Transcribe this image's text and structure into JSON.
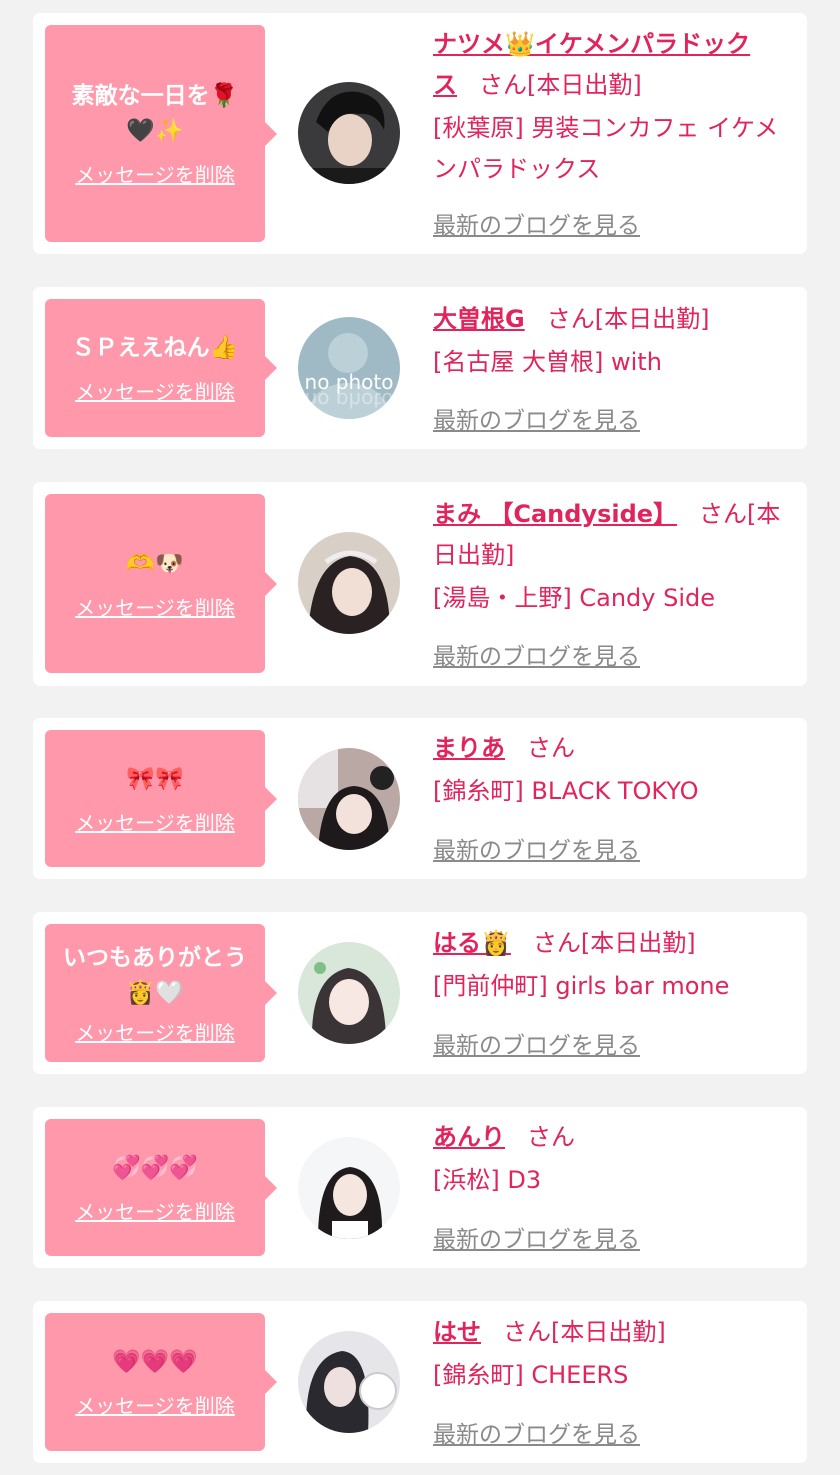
{
  "colors": {
    "background": "#f2f2f2",
    "card": "#ffffff",
    "bubble": "#fe98aa",
    "accent": "#e1245c",
    "link_gray": "#8a8a8a"
  },
  "delete_label": "メッセージを削除",
  "blog_label": "最新のブログを見る",
  "cards": [
    {
      "message": "素敵な一日を🌹🖤✨",
      "name": "ナツメ👑イケメンパラドックス",
      "suffix": "さん[本日出勤]",
      "shop": "[秋葉原] 男装コンカフェ イケメンパラドックス",
      "avatar_icon": "avatar-photo"
    },
    {
      "message": "ＳＰええねん👍",
      "name": "大曽根G",
      "suffix": "さん[本日出勤]",
      "shop": "[名古屋 大曽根] with",
      "avatar_icon": "no-photo-avatar"
    },
    {
      "message": "🫶🐶",
      "name": "まみ 【Candyside】",
      "suffix": "さん[本日出勤]",
      "shop": "[湯島・上野] Candy Side",
      "avatar_icon": "avatar-photo"
    },
    {
      "message": "🎀🎀",
      "name": "まりあ",
      "suffix": "さん",
      "shop": "[錦糸町] BLACK TOKYO",
      "avatar_icon": "avatar-photo"
    },
    {
      "message": "いつもありがとう👸🤍",
      "name": "はる👸",
      "suffix": "さん[本日出勤]",
      "shop": "[門前仲町] girls bar mone",
      "avatar_icon": "avatar-photo"
    },
    {
      "message": "💞💞💞",
      "name": "あんり",
      "suffix": "さん",
      "shop": "[浜松] D3",
      "avatar_icon": "avatar-photo"
    },
    {
      "message": "💗💗💗",
      "name": "はせ",
      "suffix": "さん[本日出勤]",
      "shop": "[錦糸町] CHEERS",
      "avatar_icon": "avatar-photo"
    }
  ]
}
